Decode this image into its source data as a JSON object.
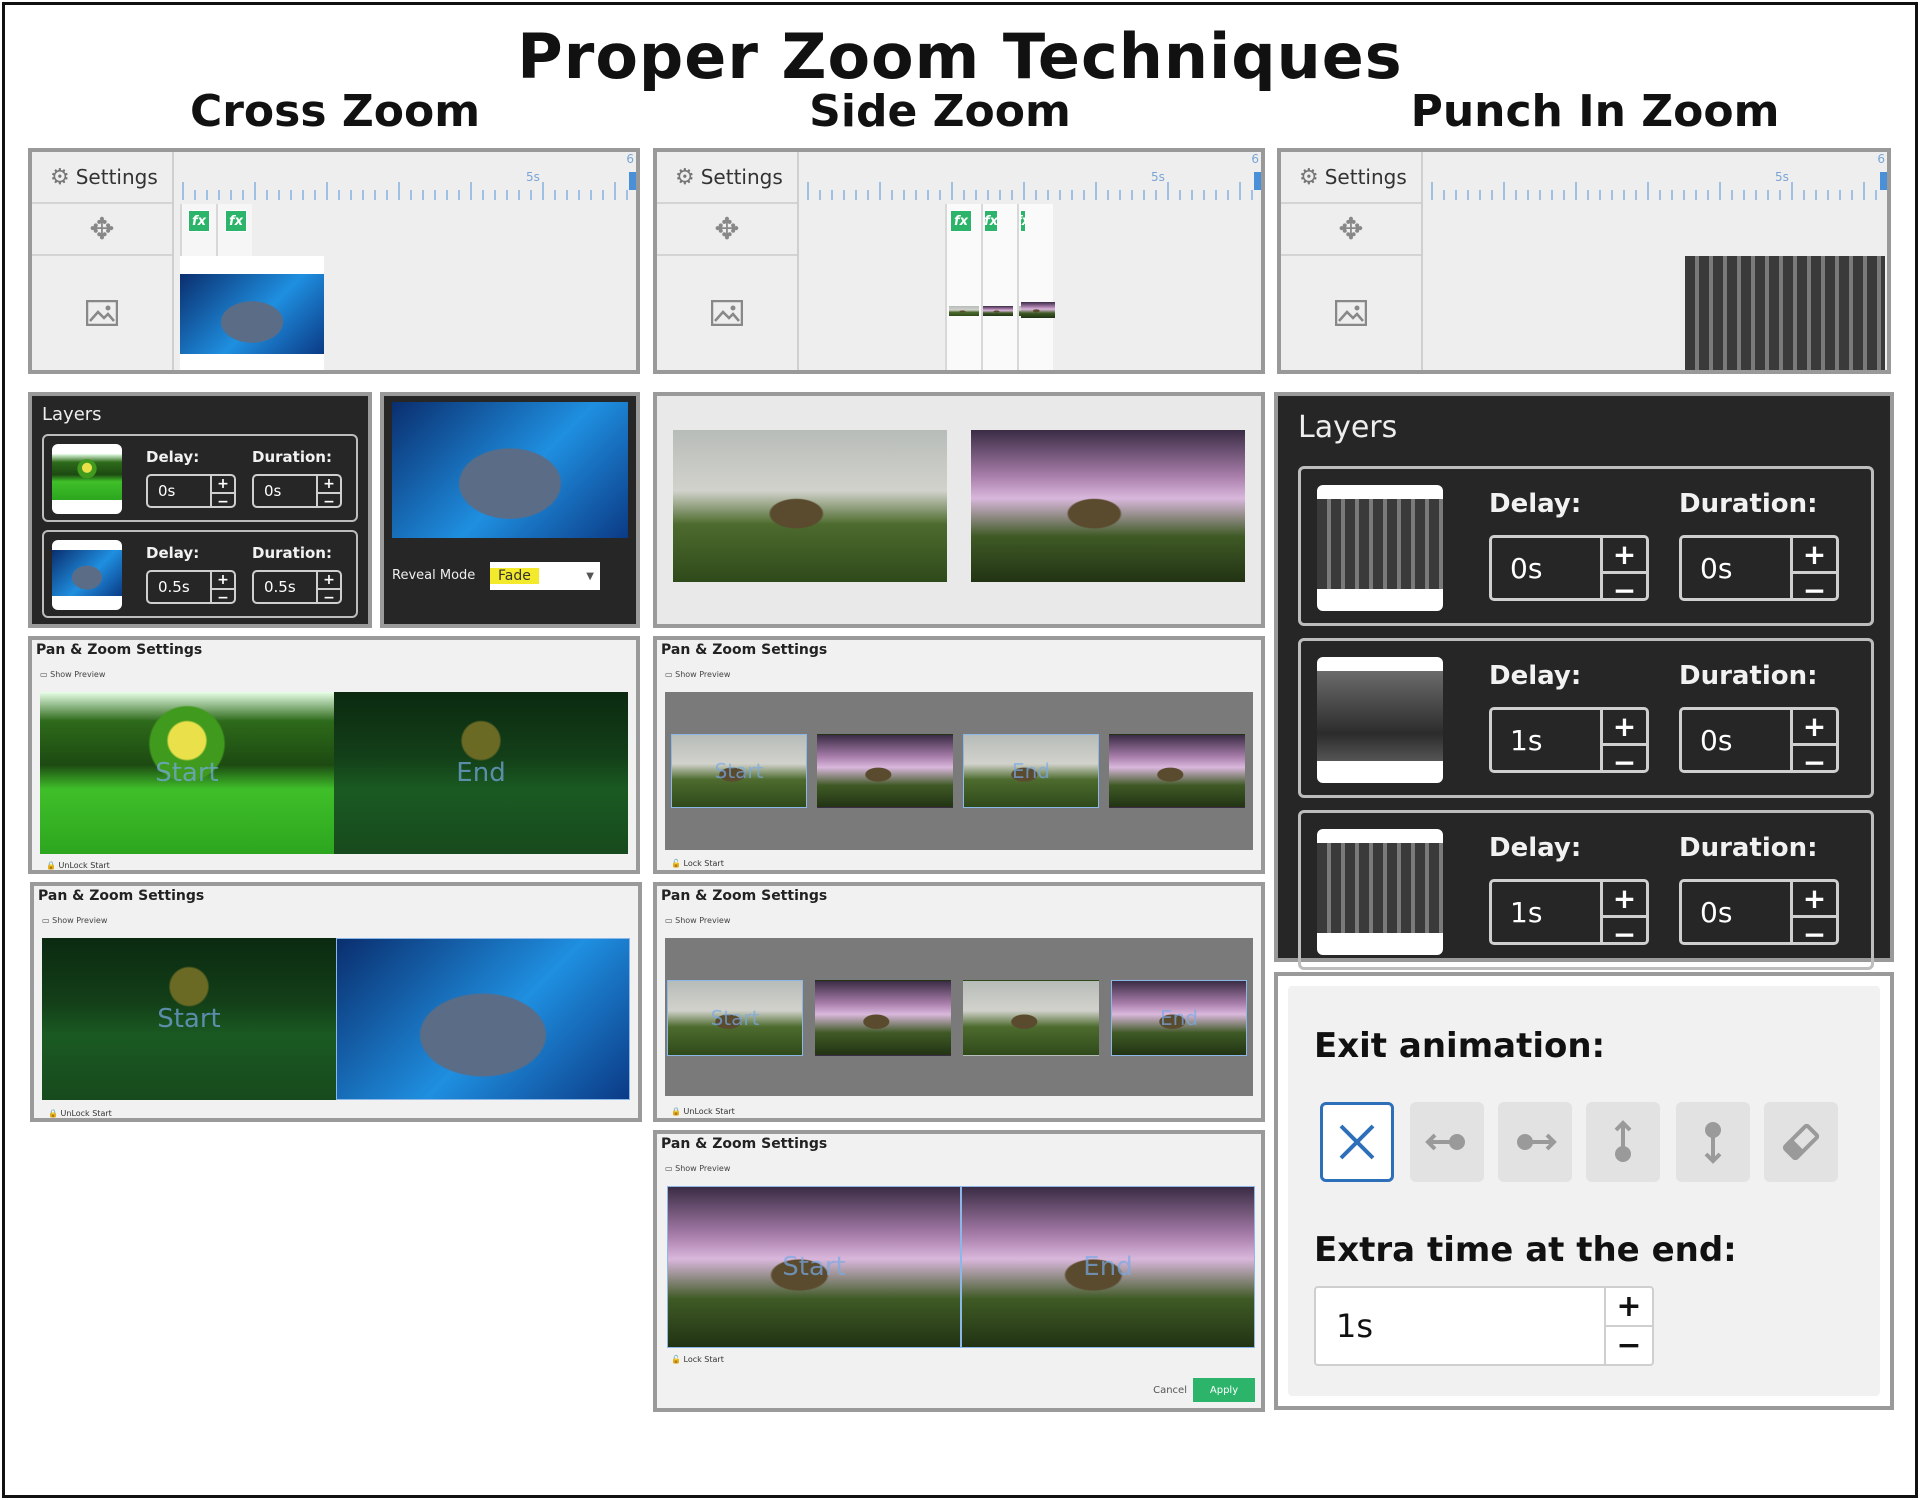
{
  "page": {
    "title": "Proper Zoom Techniques"
  },
  "columns": {
    "cross": "Cross Zoom",
    "side": "Side Zoom",
    "punch": "Punch In Zoom"
  },
  "timeline": {
    "settings_label": "Settings",
    "ruler_label": "5s",
    "ruler_end": "6"
  },
  "fx_label": "fx",
  "cross_layers": {
    "title": "Layers",
    "items": [
      {
        "delay_label": "Delay:",
        "delay": "0s",
        "duration_label": "Duration:",
        "duration": "0s"
      },
      {
        "delay_label": "Delay:",
        "delay": "0.5s",
        "duration_label": "Duration:",
        "duration": "0.5s"
      }
    ]
  },
  "reveal": {
    "label": "Reveal Mode",
    "value": "Fade"
  },
  "pan_zoom": {
    "title": "Pan & Zoom Settings",
    "show_preview": "Show Preview",
    "unlock_start": "UnLock Start",
    "lock_start": "Lock Start",
    "start": "Start",
    "end": "End",
    "cancel": "Cancel",
    "apply": "Apply"
  },
  "punch_layers": {
    "title": "Layers",
    "items": [
      {
        "delay_label": "Delay:",
        "delay": "0s",
        "duration_label": "Duration:",
        "duration": "0s"
      },
      {
        "delay_label": "Delay:",
        "delay": "1s",
        "duration_label": "Duration:",
        "duration": "0s"
      },
      {
        "delay_label": "Delay:",
        "delay": "1s",
        "duration_label": "Duration:",
        "duration": "0s"
      }
    ]
  },
  "exit": {
    "title": "Exit animation:",
    "extra_label": "Extra time at the end:",
    "extra_value": "1s",
    "buttons": [
      "none-icon",
      "slide-left-icon",
      "slide-right-icon",
      "slide-up-icon",
      "slide-down-icon",
      "eraser-icon"
    ]
  },
  "stepper": {
    "plus": "+",
    "minus": "−"
  },
  "colors": {
    "accent_blue": "#2d6fb8",
    "fx_green": "#2cb56a",
    "dark_panel": "#262626",
    "highlight_yellow": "#f2ea2a"
  }
}
